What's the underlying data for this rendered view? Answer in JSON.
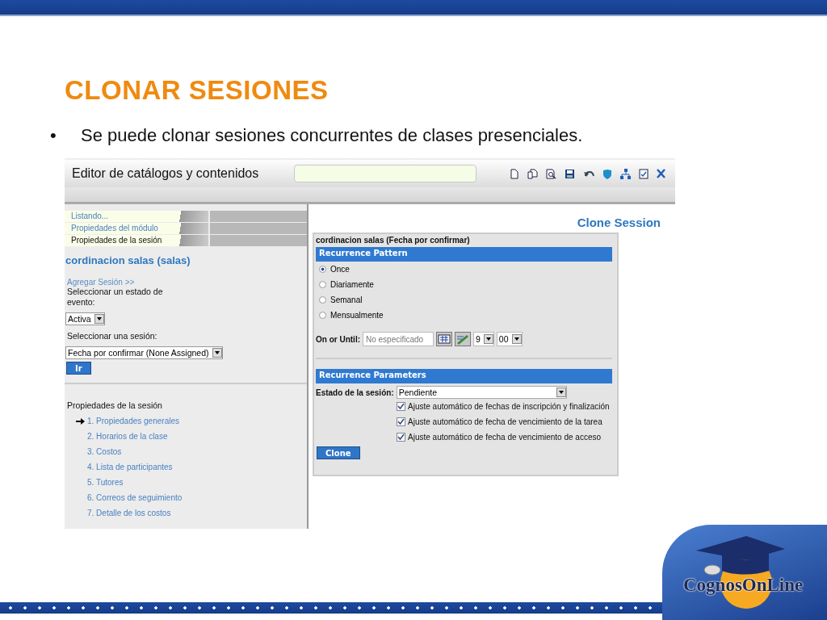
{
  "slide": {
    "title": "CLONAR SESIONES",
    "bullet_mark": "•",
    "bullet": "Se puede clonar sesiones concurrentes de clases presenciales."
  },
  "app": {
    "title": "Editor de catálogos y contenidos",
    "left": {
      "tabs": [
        {
          "label": "Listando...",
          "selected": false
        },
        {
          "label": "Propiedades del módulo",
          "selected": false
        },
        {
          "label": "Propiedades de la sesión",
          "selected": true
        }
      ],
      "heading": "cordinacion salas (salas)",
      "add_link": "Agregar Sesión >>",
      "state_label": "Seleccionar un estado de evento:",
      "state_value": "Activa",
      "session_label": "Seleccionar una sesión:",
      "session_value": "Fecha por confirmar (None Assigned)",
      "go_button": "Ir",
      "props_title": "Propiedades de la sesión",
      "props_items": [
        {
          "label": "1. Propiedades generales",
          "current": true
        },
        {
          "label": "2. Horarios de la clase",
          "current": false
        },
        {
          "label": "3. Costos",
          "current": false
        },
        {
          "label": "4. Lista de participantes",
          "current": false
        },
        {
          "label": "5. Tutores",
          "current": false
        },
        {
          "label": "6. Correos de seguimiento",
          "current": false
        },
        {
          "label": "7. Detalle de los costos",
          "current": false
        }
      ]
    },
    "right": {
      "title": "Clone Session",
      "caption": "cordinacion salas (Fecha por confirmar)",
      "pattern_header": "Recurrence Pattern",
      "options": [
        {
          "label": "Once",
          "selected": true
        },
        {
          "label": "Diariamente",
          "selected": false
        },
        {
          "label": "Semanal",
          "selected": false
        },
        {
          "label": "Mensualmente",
          "selected": false
        }
      ],
      "until_label": "On or Until:",
      "until_placeholder": "No especificado",
      "hour": "9",
      "minute": "00",
      "params_header": "Recurrence Parameters",
      "status_label": "Estado de la sesión:",
      "status_value": "Pendiente",
      "checks": [
        {
          "label": "Ajuste automático de fechas de inscripción y finalización",
          "checked": true
        },
        {
          "label": "Ajuste automático de fecha de vencimiento de la tarea",
          "checked": true
        },
        {
          "label": "Ajuste automático de fecha de vencimiento de acceso",
          "checked": true
        }
      ],
      "clone_button": "Clone"
    }
  },
  "logo": {
    "name": "CognosOnLine"
  }
}
